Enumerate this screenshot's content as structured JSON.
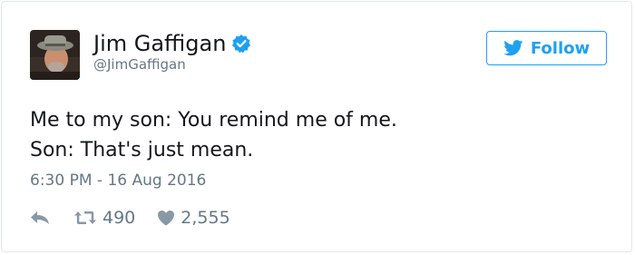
{
  "user": {
    "display_name": "Jim Gaffigan",
    "handle": "@JimGaffigan",
    "verified": true
  },
  "follow_button": {
    "label": "Follow",
    "icon": "twitter-bird-icon"
  },
  "tweet": {
    "lines": [
      "Me to my son: You remind me of me.",
      "Son: That's just mean."
    ],
    "timestamp": "6:30 PM - 16 Aug 2016"
  },
  "actions": {
    "reply_icon": "reply-icon",
    "retweet_icon": "retweet-icon",
    "retweet_count": "490",
    "like_icon": "heart-icon",
    "like_count": "2,555"
  },
  "colors": {
    "accent": "#1da1f2",
    "secondary_text": "#657786",
    "primary_text": "#14171a",
    "border": "#e1e8ed",
    "icon_gray": "#8899a6"
  }
}
